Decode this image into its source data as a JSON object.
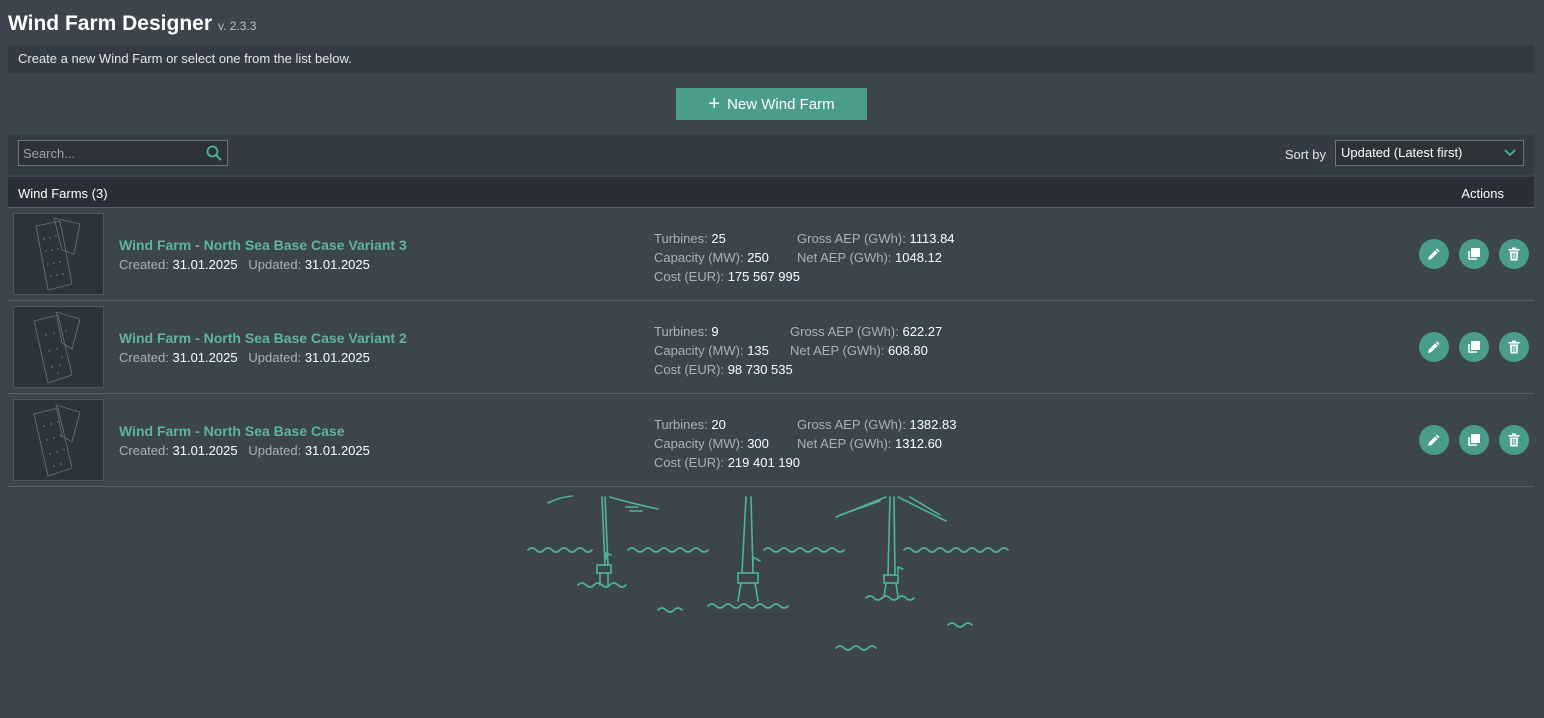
{
  "app": {
    "title": "Wind Farm Designer",
    "version": "v. 2.3.3"
  },
  "info": {
    "message": "Create a new Wind Farm or select one from the list below."
  },
  "new_button": {
    "label": "New Wind Farm"
  },
  "search": {
    "placeholder": "Search..."
  },
  "sort": {
    "label": "Sort by",
    "selected": "Updated (Latest first)"
  },
  "list": {
    "header": "Wind Farms (3)",
    "actions_header": "Actions",
    "labels": {
      "created": "Created:",
      "updated": "Updated:",
      "turbines": "Turbines:",
      "capacity": "Capacity (MW):",
      "cost": "Cost (EUR):",
      "gross": "Gross AEP (GWh):",
      "net": "Net AEP (GWh):"
    },
    "farms": [
      {
        "name": "Wind Farm - North Sea Base Case Variant 3",
        "created": "31.01.2025",
        "updated": "31.01.2025",
        "turbines": "25",
        "capacity": "250",
        "cost": "175 567 995",
        "gross_aep": "1113.84",
        "net_aep": "1048.12"
      },
      {
        "name": "Wind Farm - North Sea Base Case Variant 2",
        "created": "31.01.2025",
        "updated": "31.01.2025",
        "turbines": "9",
        "capacity": "135",
        "cost": "98 730 535",
        "gross_aep": "622.27",
        "net_aep": "608.80"
      },
      {
        "name": "Wind Farm - North Sea Base Case",
        "created": "31.01.2025",
        "updated": "31.01.2025",
        "turbines": "20",
        "capacity": "300",
        "cost": "219 401 190",
        "gross_aep": "1382.83",
        "net_aep": "1312.60"
      }
    ]
  },
  "colors": {
    "accent": "#4a9d8a",
    "link": "#5fb3a3",
    "background": "#3c444d",
    "panel": "#343b43"
  }
}
